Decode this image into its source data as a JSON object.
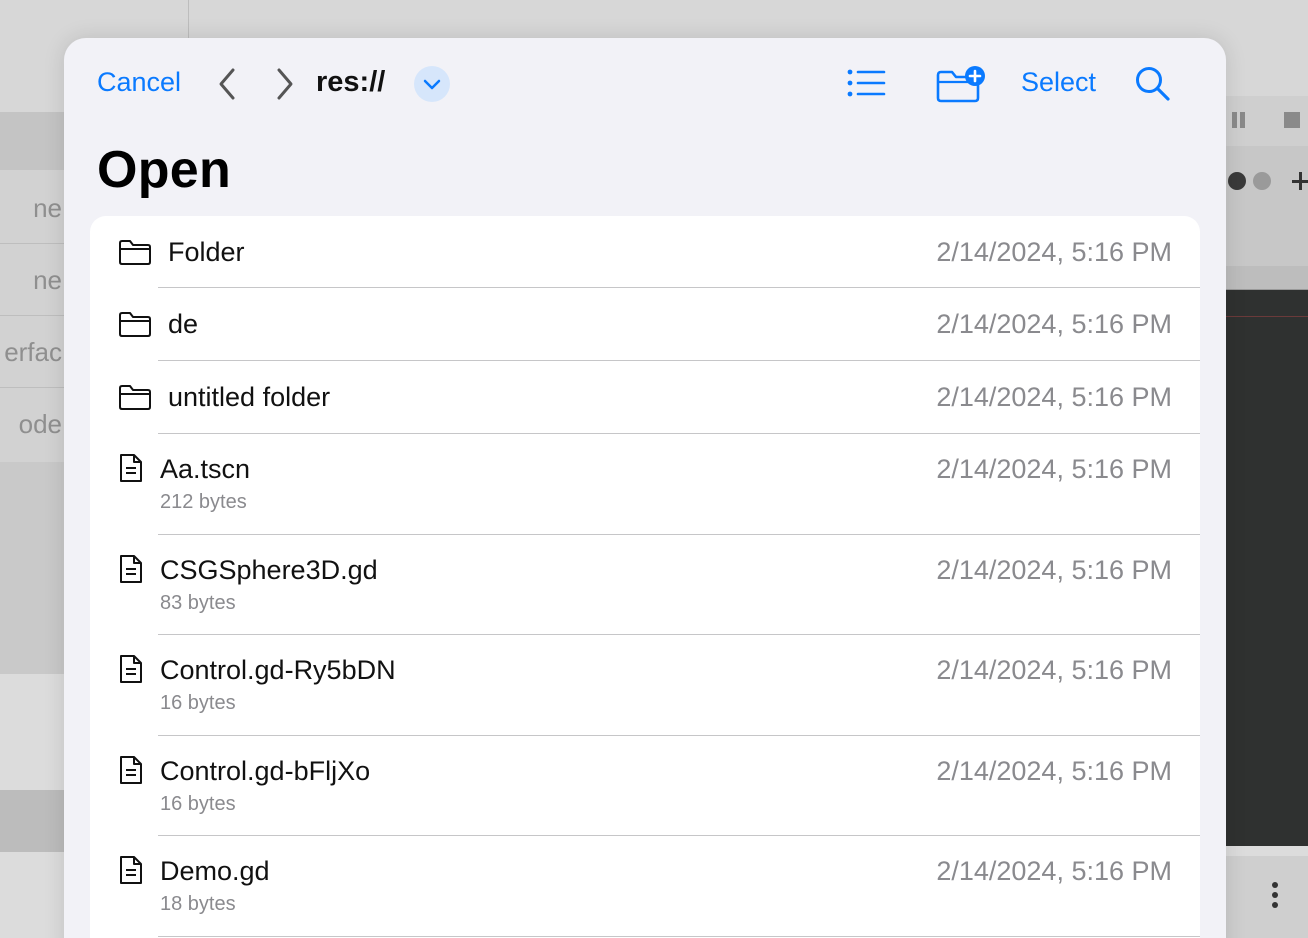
{
  "background": {
    "sidebar_items": [
      "ne",
      "ne",
      "erfac",
      "ode"
    ]
  },
  "nav": {
    "cancel_label": "Cancel",
    "path": "res://",
    "select_label": "Select",
    "accent_color": "#0A7AFF",
    "icons": [
      "chevron-left-icon",
      "chevron-right-icon",
      "chevron-down-icon",
      "list-view-icon",
      "new-folder-icon",
      "search-icon"
    ]
  },
  "title": "Open",
  "files": [
    {
      "type": "folder",
      "name": "Folder",
      "date": "2/14/2024, 5:16 PM"
    },
    {
      "type": "folder",
      "name": "de",
      "date": "2/14/2024, 5:16 PM"
    },
    {
      "type": "folder",
      "name": "untitled folder",
      "date": "2/14/2024, 5:16 PM"
    },
    {
      "type": "file",
      "name": "Aa.tscn",
      "size": "212 bytes",
      "date": "2/14/2024, 5:16 PM"
    },
    {
      "type": "file",
      "name": "CSGSphere3D.gd",
      "size": "83 bytes",
      "date": "2/14/2024, 5:16 PM"
    },
    {
      "type": "file",
      "name": "Control.gd-Ry5bDN",
      "size": "16 bytes",
      "date": "2/14/2024, 5:16 PM"
    },
    {
      "type": "file",
      "name": "Control.gd-bFljXo",
      "size": "16 bytes",
      "date": "2/14/2024, 5:16 PM"
    },
    {
      "type": "file",
      "name": "Demo.gd",
      "size": "18 bytes",
      "date": "2/14/2024, 5:16 PM"
    }
  ]
}
